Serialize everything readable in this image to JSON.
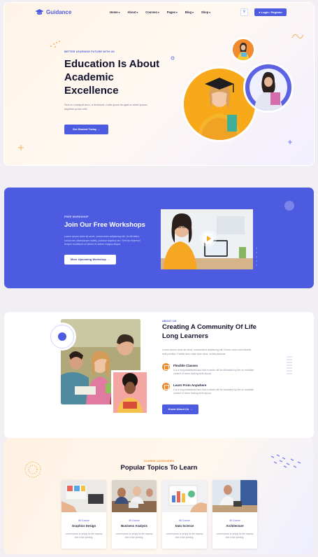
{
  "nav": {
    "logo": "Guidance",
    "menu": [
      "Home",
      "About",
      "Courses",
      "Pages",
      "Blog",
      "Shop"
    ],
    "search_icon": "search-icon",
    "login_label": "Login / Register"
  },
  "hero": {
    "eyebrow": "BETTER LEARNING FUTURE WITH US",
    "title": "Education Is About Academic Excellence",
    "description": "Sed eu volutpat arcu, a tincidunt. nulla quam feugiat ut amet ipsum, dapibus porta velit.",
    "cta": "Get Started Today →"
  },
  "workshop": {
    "eyebrow": "FREE WORKSHOP",
    "title": "Join Our Free Workshops",
    "description": "Lorem ipsum dolor sit amet, consectetur adipiscing elit. Ut elit tellus, luctus nec ullamcorper mattis, pulvinar dapibus leo. Sed do eiusmod tempor incididunt ut labore et dolore magna aliqua.",
    "cta": "More Upcoming Workshop →"
  },
  "community": {
    "eyebrow": "ABOUT US",
    "title": "Creating A Community Of Life Long Learners",
    "description": "Lorem ipsum dolor sit amet, consectetur adipiscing elit. Donec nunc mol lobortis velit porttitor. Facilisi arcu vitae sem risus, vivida placerat.",
    "features": [
      {
        "title": "Flexible Classes",
        "text": "It is a long established fact that a reader will be distracted by the on readable content of when looking at its layout."
      },
      {
        "title": "Learn From Anywhere",
        "text": "It is a long established fact that a reader will be distracted by the on readable content of when looking at its layout."
      }
    ],
    "cta": "Know About Us →"
  },
  "topics": {
    "eyebrow": "COURSE CATEGORIES",
    "title": "Popular Topics To Learn",
    "courses": [
      {
        "tag": "68 Course",
        "name": "Graphics Design",
        "text": "Lorem ipsum is simply for the dummy text of the printing."
      },
      {
        "tag": "45 Course",
        "name": "Business Analysis",
        "text": "Lorem ipsum is simply for the dummy text of the printing."
      },
      {
        "tag": "68 Course",
        "name": "Data Science",
        "text": "Lorem ipsum is simply for the dummy text of the printing."
      },
      {
        "tag": "45 Course",
        "name": "Architecture",
        "text": "Lorem ipsum is simply for the dummy text of the printing."
      }
    ]
  },
  "colors": {
    "accent": "#4d5be0",
    "orange": "#f28a2e",
    "yellow": "#f7a91a"
  }
}
